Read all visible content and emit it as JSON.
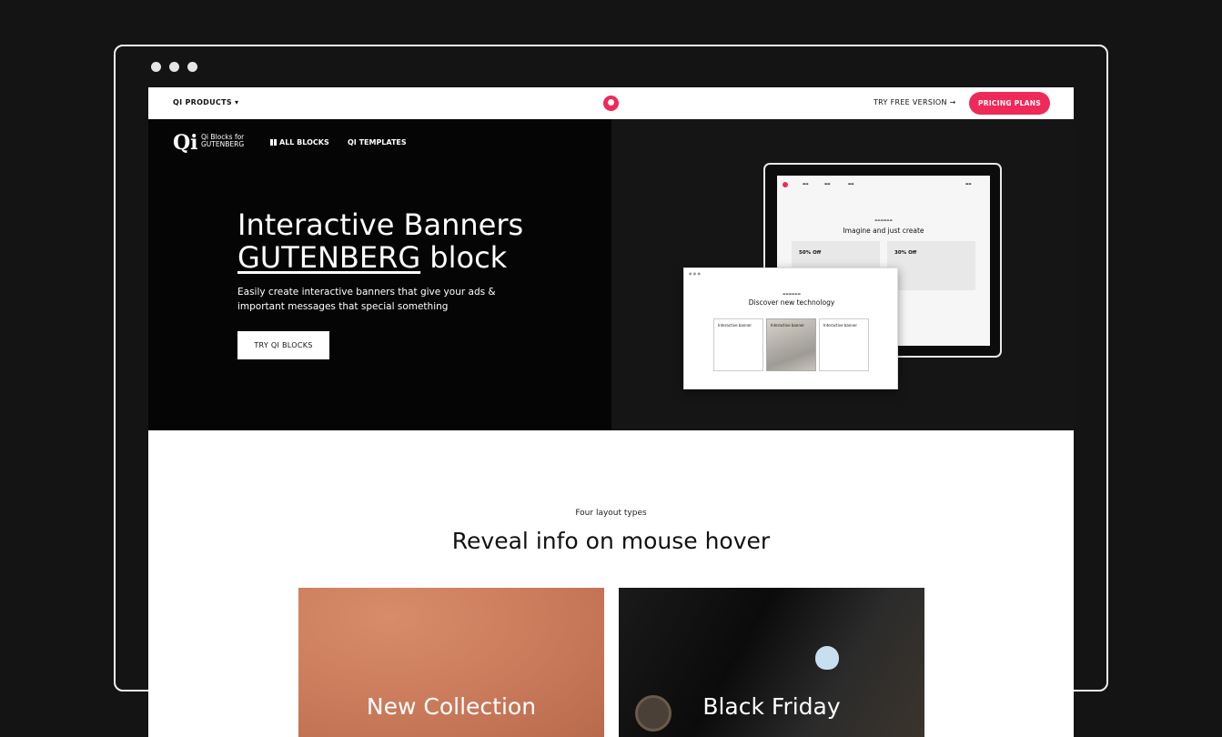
{
  "topbar": {
    "products_label": "QI PRODUCTS ▾",
    "try_free_label": "TRY FREE VERSION →",
    "pricing_label": "PRICING PLANS"
  },
  "hero": {
    "brand_line1": "Qi Blocks for",
    "brand_line2": "GUTENBERG",
    "nav_all_blocks": "ALL BLOCKS",
    "nav_templates": "QI TEMPLATES",
    "title_line1": "Interactive Banners",
    "title_highlight": "GUTENBERG",
    "title_rest": " block",
    "description": "Easily create interactive banners that give your ads & important messages that special something",
    "cta_label": "TRY QI BLOCKS"
  },
  "preview": {
    "tablet_heading": "Imagine and just create",
    "tablet_cards": [
      "50% Off",
      "30% Off"
    ],
    "browser_heading": "Discover new technology",
    "browser_cards": [
      "Interactive banner",
      "Interactive banner",
      "Interactive banner"
    ]
  },
  "section": {
    "kicker": "Four layout types",
    "title": "Reveal info on mouse hover"
  },
  "banners": [
    {
      "label": "New Collection"
    },
    {
      "label": "Black Friday"
    }
  ],
  "colors": {
    "accent": "#ef2a58",
    "background": "#141414"
  }
}
